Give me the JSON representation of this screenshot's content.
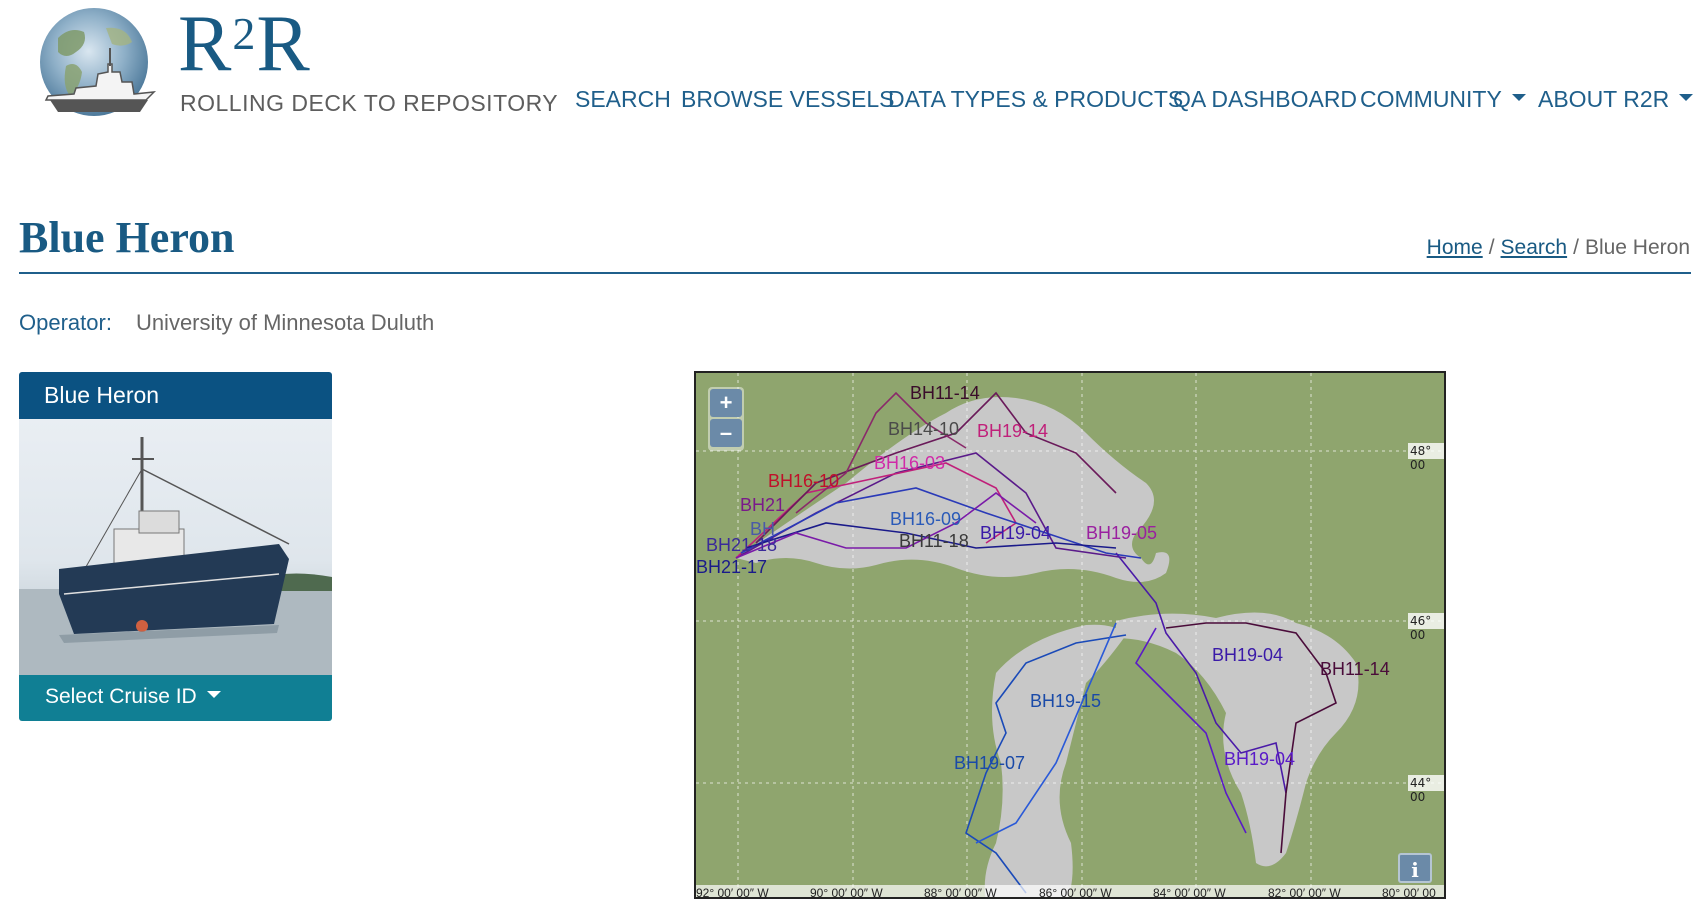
{
  "brand": {
    "title": "R2R",
    "subtitle": "ROLLING DECK TO REPOSITORY"
  },
  "nav": {
    "items": [
      {
        "label": "SEARCH"
      },
      {
        "label": "BROWSE VESSELS"
      },
      {
        "label": "DATA TYPES & PRODUCTS"
      },
      {
        "label": "QA DASHBOARD"
      },
      {
        "label": "COMMUNITY",
        "dropdown": true
      },
      {
        "label": "ABOUT R2R",
        "dropdown": true
      }
    ]
  },
  "page": {
    "title": "Blue Heron",
    "breadcrumb": {
      "home": "Home",
      "search": "Search",
      "current": "Blue Heron",
      "separator": "/"
    },
    "operator_label": "Operator:",
    "operator_value": "University of Minnesota Duluth"
  },
  "vessel_card": {
    "name": "Blue Heron",
    "select_label": "Select Cruise ID"
  },
  "map": {
    "zoom_in": "+",
    "zoom_out": "–",
    "info": "i",
    "lat_labels": [
      "48° 00",
      "46° 00",
      "44° 00"
    ],
    "lon_labels": [
      "92° 00′ 00″ W",
      "90° 00′ 00″ W",
      "88° 00′ 00″ W",
      "86° 00′ 00″ W",
      "84° 00′ 00″ W",
      "82° 00′ 00″ W",
      "80° 00′ 00"
    ],
    "cruise_labels": [
      {
        "id": "BH11-14",
        "color": "#3a0c2a"
      },
      {
        "id": "BH14-10",
        "color": "#4a4a4a"
      },
      {
        "id": "BH19-14",
        "color": "#c0207a"
      },
      {
        "id": "BH16-03",
        "color": "#d02aa8"
      },
      {
        "id": "BH16-10",
        "color": "#c0102a"
      },
      {
        "id": "BH21",
        "color": "#7a1a8a"
      },
      {
        "id": "BH",
        "color": "#4a5aa8"
      },
      {
        "id": "BH16-09",
        "color": "#2a5ab8"
      },
      {
        "id": "BH21-18",
        "color": "#3a2a9a"
      },
      {
        "id": "BH21-17",
        "color": "#1a1a8a"
      },
      {
        "id": "BH11-18",
        "color": "#3a3a3a"
      },
      {
        "id": "BH19-04",
        "color": "#3a1aa8"
      },
      {
        "id": "BH19-05",
        "color": "#9a20a0"
      },
      {
        "id": "BH19-04",
        "color": "#3a1aa8"
      },
      {
        "id": "BH11-14",
        "color": "#4a0c3a"
      },
      {
        "id": "BH19-15",
        "color": "#1a4aa8"
      },
      {
        "id": "BH19-07",
        "color": "#1a4aa8"
      },
      {
        "id": "BH19-04",
        "color": "#5a1ac8"
      }
    ]
  }
}
